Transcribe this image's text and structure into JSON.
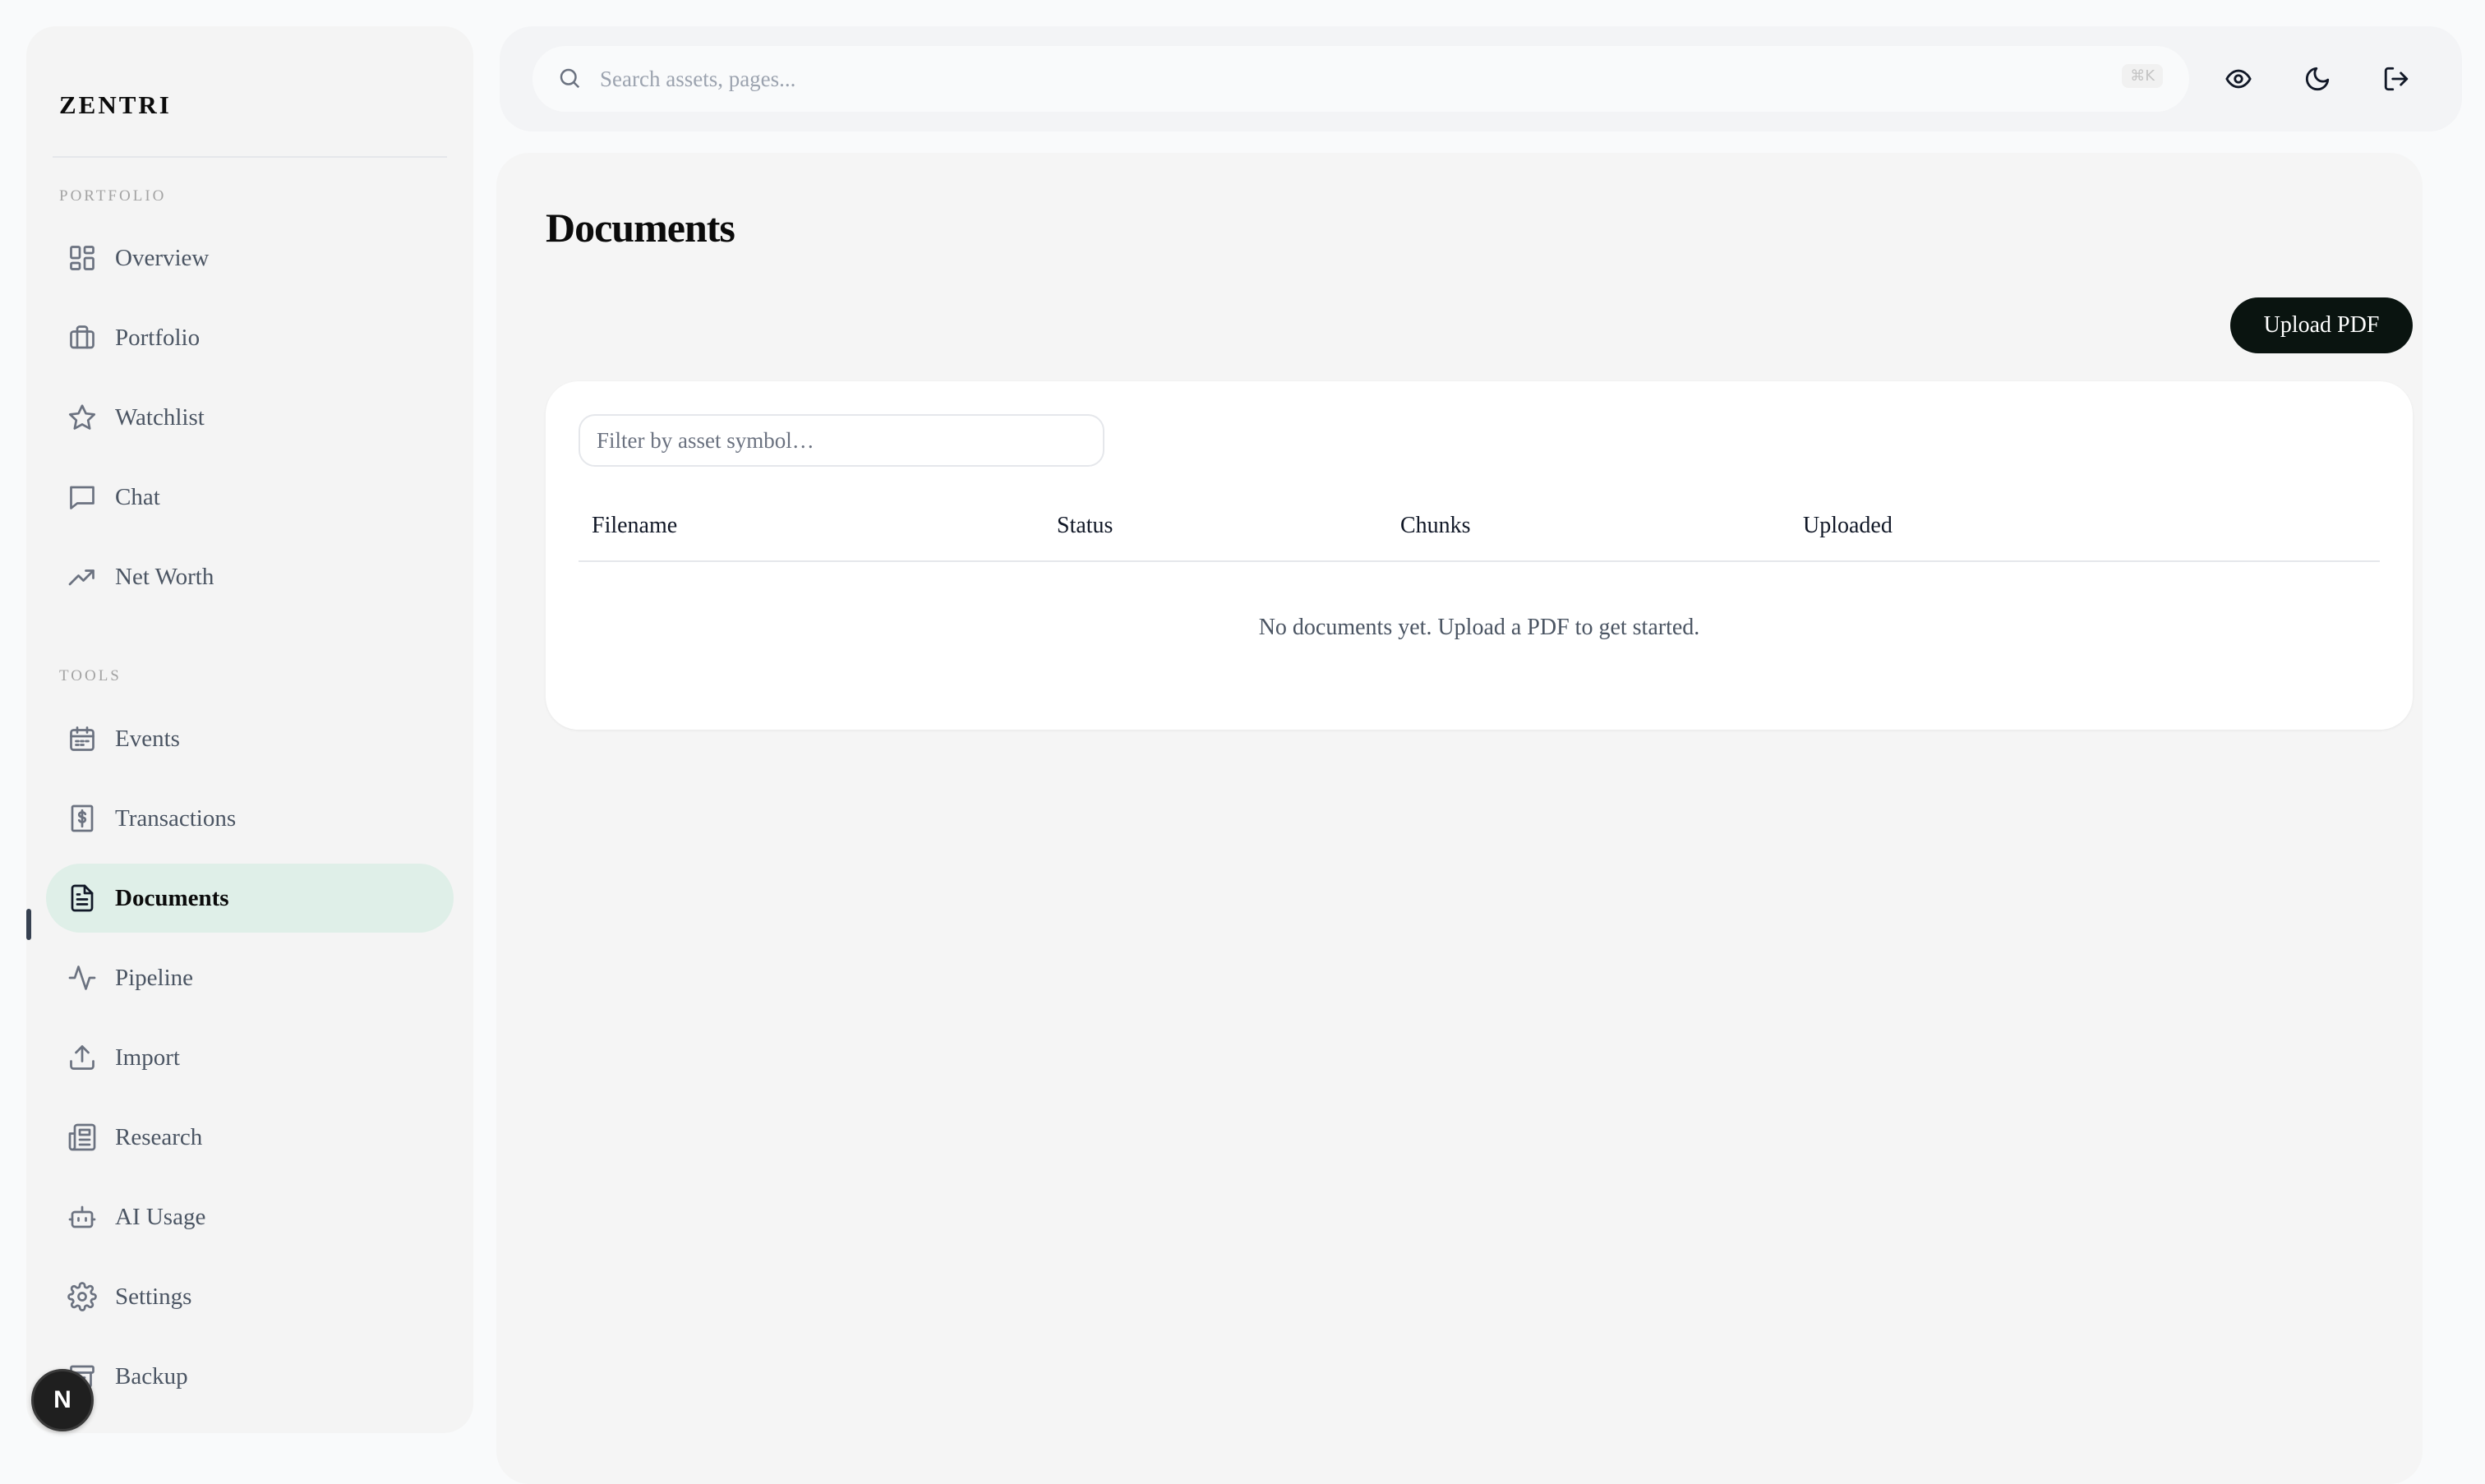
{
  "app": {
    "brand": "ZENTRI"
  },
  "sidebar": {
    "sections": [
      {
        "label": "PORTFOLIO"
      },
      {
        "label": "TOOLS"
      }
    ],
    "portfolio_items": [
      {
        "label": "Overview",
        "icon": "grid-icon"
      },
      {
        "label": "Portfolio",
        "icon": "briefcase-icon"
      },
      {
        "label": "Watchlist",
        "icon": "star-icon"
      },
      {
        "label": "Chat",
        "icon": "message-icon"
      },
      {
        "label": "Net Worth",
        "icon": "trending-up-icon"
      }
    ],
    "tools_items": [
      {
        "label": "Events",
        "icon": "calendar-icon"
      },
      {
        "label": "Transactions",
        "icon": "receipt-icon"
      },
      {
        "label": "Documents",
        "icon": "file-text-icon",
        "active": true
      },
      {
        "label": "Pipeline",
        "icon": "activity-icon"
      },
      {
        "label": "Import",
        "icon": "upload-icon"
      },
      {
        "label": "Research",
        "icon": "newspaper-icon"
      },
      {
        "label": "AI Usage",
        "icon": "bot-icon"
      },
      {
        "label": "Settings",
        "icon": "gear-icon"
      },
      {
        "label": "Backup",
        "icon": "archive-icon"
      }
    ],
    "avatar_letter": "N"
  },
  "topbar": {
    "search_placeholder": "Search assets, pages...",
    "shortcut": "⌘K",
    "icons": [
      "eye-icon",
      "moon-icon",
      "logout-icon"
    ]
  },
  "main": {
    "title": "Documents",
    "upload_label": "Upload PDF",
    "filter_placeholder": "Filter by asset symbol…",
    "columns": [
      "Filename",
      "Status",
      "Chunks",
      "Uploaded"
    ],
    "empty_message": "No documents yet. Upload a PDF to get started."
  },
  "colors": {
    "active_nav_bg": "#dfefe8",
    "primary_button": "#0a1410"
  }
}
